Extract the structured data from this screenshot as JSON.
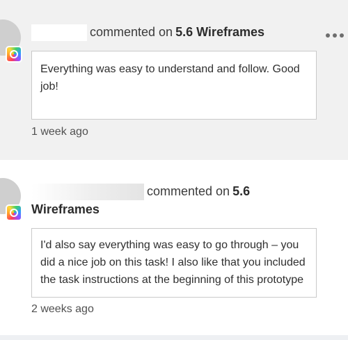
{
  "comments": [
    {
      "author": "",
      "verb": "commented on",
      "target": "5.6 Wireframes",
      "body": "Everything was easy to understand and follow. Good job!",
      "time": "1 week ago",
      "app_icon": "creative-cloud-icon",
      "menu_icon": "more-options-icon"
    },
    {
      "author": "",
      "verb": "commented on",
      "target_part1": "5.6",
      "target_part2": "Wireframes",
      "body": "I'd also say everything was easy to go through – you did a nice job on this task! I also like that you included the task instructions at the beginning of this prototype",
      "time": "2 weeks ago",
      "app_icon": "creative-cloud-icon"
    }
  ],
  "colors": {
    "card_highlight": "#f1f1f1",
    "text_primary": "#2c2c2c",
    "border": "#c9c9c9"
  }
}
